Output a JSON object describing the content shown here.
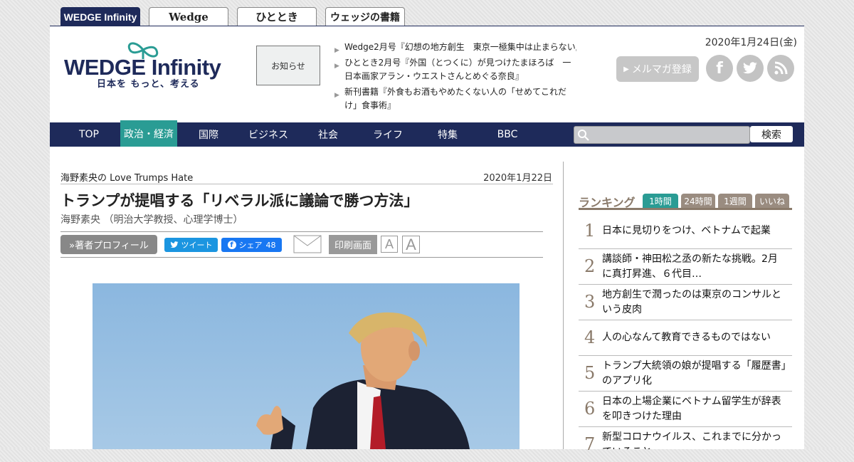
{
  "site_tabs": [
    "WEDGE Infinity",
    "Wedge",
    "ひととき",
    "ウェッジの書籍"
  ],
  "header": {
    "logo": "WEDGE Infinity",
    "tagline": "日本を もっと、考える",
    "notice_label": "お知らせ",
    "news": [
      "Wedge2月号『幻想の地方創生　東京一極集中は止まらない』",
      "ひととき2月号『外国（とつくに）が見つけたまほろば　一日本画家アラン・ウエストさんとめぐる奈良』",
      "新刊書籍『外食もお酒もやめたくない人の「せめてこれだけ」食事術』"
    ],
    "date": "2020年1月24日(金)",
    "mailmag_label": "メルマガ登録",
    "social": [
      "facebook-icon",
      "twitter-icon",
      "rss-icon"
    ]
  },
  "nav": {
    "items": [
      "TOP",
      "政治・経済",
      "国際",
      "ビジネス",
      "社会",
      "ライフ",
      "特集",
      "BBC"
    ],
    "active_index": 1,
    "search_button": "検索",
    "search_placeholder": ""
  },
  "article": {
    "series": "海野素央の Love Trumps Hate",
    "date": "2020年1月22日",
    "title": "トランプが提唱する「リベラル派に議論で勝つ方法」",
    "author": "海野素央 （明治大学教授、心理学博士）",
    "profile_button": "»著者プロフィール",
    "tweet_label": "ツイート",
    "share_label": "シェア",
    "share_count": "48",
    "print_label": "印刷画面",
    "font_small": "A",
    "font_large": "A"
  },
  "ranking": {
    "title": "ランキング",
    "tabs": [
      "1時間",
      "24時間",
      "1週間",
      "いいね"
    ],
    "active_tab": 0,
    "items": [
      {
        "num": "1",
        "text": "日本に見切りをつけ、ベトナムで起業"
      },
      {
        "num": "2",
        "text": "講談師・神田松之丞の新たな挑戦。2月に真打昇進、６代目…"
      },
      {
        "num": "3",
        "text": "地方創生で潤ったのは東京のコンサルという皮肉"
      },
      {
        "num": "4",
        "text": "人の心なんて教育できるものではない"
      },
      {
        "num": "5",
        "text": "トランプ大統領の娘が提唱する「履歴書」のアプリ化"
      },
      {
        "num": "6",
        "text": "日本の上場企業にベトナム留学生が辞表を叩きつけた理由"
      },
      {
        "num": "7",
        "text": "新型コロナウイルス、これまでに分かっていること"
      }
    ]
  },
  "colors": {
    "navy": "#1e2a5a",
    "teal": "#2a9c94",
    "rank_brown": "#8a7a6a"
  }
}
